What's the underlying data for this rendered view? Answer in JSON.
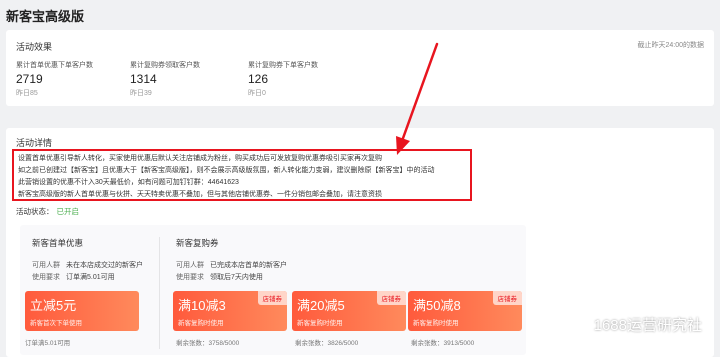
{
  "page": {
    "title": "新客宝高级版"
  },
  "effect": {
    "title": "活动效果",
    "updated": "截止昨天24:00的数据",
    "stats": [
      {
        "label": "累计首单优惠下单客户数",
        "value": "2719",
        "yesterday": "昨日85"
      },
      {
        "label": "累计复购券领取客户数",
        "value": "1314",
        "yesterday": "昨日39"
      },
      {
        "label": "累计复购券下单客户数",
        "value": "126",
        "yesterday": "昨日0"
      }
    ]
  },
  "detail": {
    "title": "活动详情",
    "description": [
      "设置首单优惠引导新人转化，买家使用优惠后默认关注店铺成为粉丝，购买成功后可发放复购优惠券吸引买家再次复购",
      "如之前已创建过【新客宝】且优惠大于【新客宝高级版】，则不会展示高级版氛围，新人转化能力变弱，建议删除原【新客宝】中的活动",
      "此营销设置的优惠不计入30天最低价，如有问题可加钉钉群：44641623",
      "新客宝高级版的新人首单优惠与伙拼、天天特卖优惠不叠加，但与其他店铺优惠券、一件分销包邮会叠加，请注意资损"
    ],
    "status_label": "活动状态：",
    "status_value": "已开启"
  },
  "first_order": {
    "title": "新客首单优惠",
    "target_label": "可用人群",
    "target_value": "未在本店成交过的新客户",
    "requirement_label": "使用要求",
    "requirement_value": "订单满5.01可用",
    "ticket": {
      "main": "立减5元",
      "sub": "新客首次下单使用"
    },
    "footer": "订单满5.01可用"
  },
  "repurchase": {
    "title": "新客复购券",
    "target_label": "可用人群",
    "target_value": "已完成本店首单的新客户",
    "requirement_label": "使用要求",
    "requirement_value": "领取后7天内使用",
    "tickets": [
      {
        "main": "满10减3",
        "tag": "店铺券",
        "sub": "新客复购时使用",
        "remain": "剩余张数：3758/5000"
      },
      {
        "main": "满20减5",
        "tag": "店铺券",
        "sub": "新客复购时使用",
        "remain": "剩余张数：3826/5000"
      },
      {
        "main": "满50减8",
        "tag": "店铺券",
        "sub": "新客复购时使用",
        "remain": "剩余张数：3913/5000"
      }
    ]
  },
  "watermark": {
    "text": "1688运营研究社",
    "icon": "wechat-icon"
  },
  "colors": {
    "accent": "#e8151f",
    "coupon": "#ff6a45",
    "status_on": "#4caf50"
  }
}
